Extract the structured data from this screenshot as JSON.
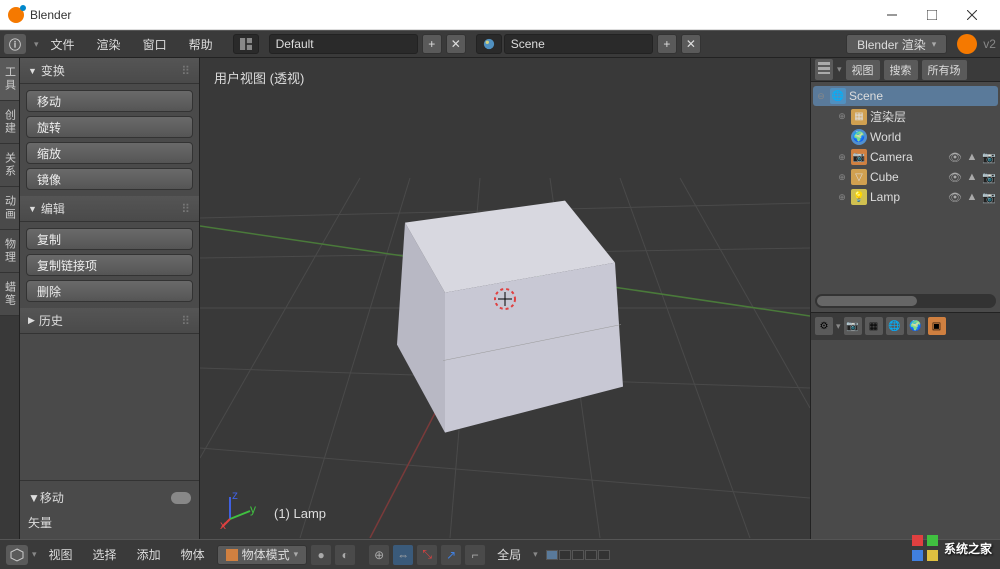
{
  "window": {
    "title": "Blender"
  },
  "menubar": {
    "items": [
      "文件",
      "渲染",
      "窗口",
      "帮助"
    ],
    "layout": "Default",
    "scene": "Scene",
    "engine": "Blender 渲染",
    "version": "v2"
  },
  "left_tabs": [
    "工具",
    "创建",
    "关系",
    "动画",
    "物理",
    "蜡笔"
  ],
  "toolpanel": {
    "transform": {
      "header": "变换",
      "btns": [
        "移动",
        "旋转",
        "缩放",
        "镜像"
      ]
    },
    "edit": {
      "header": "编辑",
      "btns": [
        "复制",
        "复制链接项",
        "删除"
      ]
    },
    "history": {
      "header": "历史"
    },
    "bottom": {
      "header": "移动",
      "vector": "矢量"
    }
  },
  "viewport": {
    "label": "用户视图  (透视)",
    "object": "(1)  Lamp"
  },
  "outliner": {
    "header": [
      "视图",
      "搜索",
      "所有场"
    ],
    "scene": "Scene",
    "items": [
      {
        "label": "渲染层",
        "icon": "layers",
        "color": "#d0a050"
      },
      {
        "label": "World",
        "icon": "world",
        "color": "#5090d0"
      },
      {
        "label": "Camera",
        "icon": "camera",
        "color": "#d08040",
        "expandable": true,
        "actions": true
      },
      {
        "label": "Cube",
        "icon": "cube",
        "color": "#d0a050",
        "expandable": true,
        "actions": true
      },
      {
        "label": "Lamp",
        "icon": "lamp",
        "color": "#d0c050",
        "expandable": true,
        "actions": true
      }
    ]
  },
  "bottom": {
    "menus": [
      "视图",
      "选择",
      "添加",
      "物体"
    ],
    "mode": "物体模式",
    "orient": "全局"
  },
  "watermark": "系统之家"
}
